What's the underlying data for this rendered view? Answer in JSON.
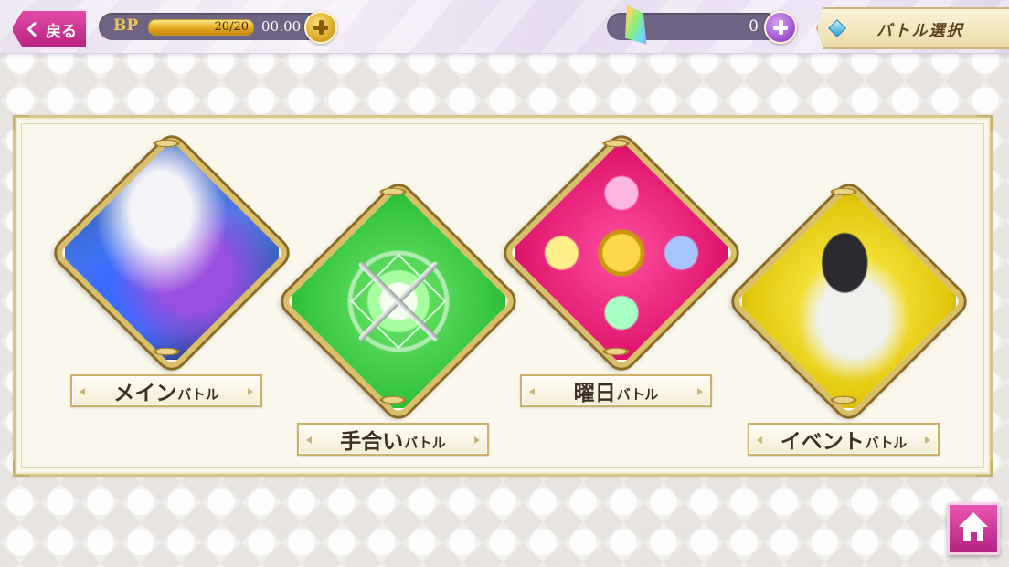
{
  "header": {
    "back_label": "戻る",
    "bp_label": "BP",
    "bp_value": "20/20",
    "bp_fill_fraction": 1.0,
    "bp_timer": "00:00",
    "stone_count": "0",
    "screen_title": "バトル選択"
  },
  "battles": [
    {
      "id": "main",
      "name": "メイン",
      "suffix": "バトル"
    },
    {
      "id": "training",
      "name": "手合い",
      "suffix": "バトル"
    },
    {
      "id": "weekday",
      "name": "曜日",
      "suffix": "バトル"
    },
    {
      "id": "event",
      "name": "イベント",
      "suffix": "バトル"
    }
  ],
  "colors": {
    "accent_pink": "#d2379a",
    "gold": "#d9bf6a",
    "panel_bg": "#faf7ec"
  },
  "icons": [
    "chevron-left-icon",
    "plus-icon",
    "rainbow-stone-icon",
    "home-icon"
  ]
}
